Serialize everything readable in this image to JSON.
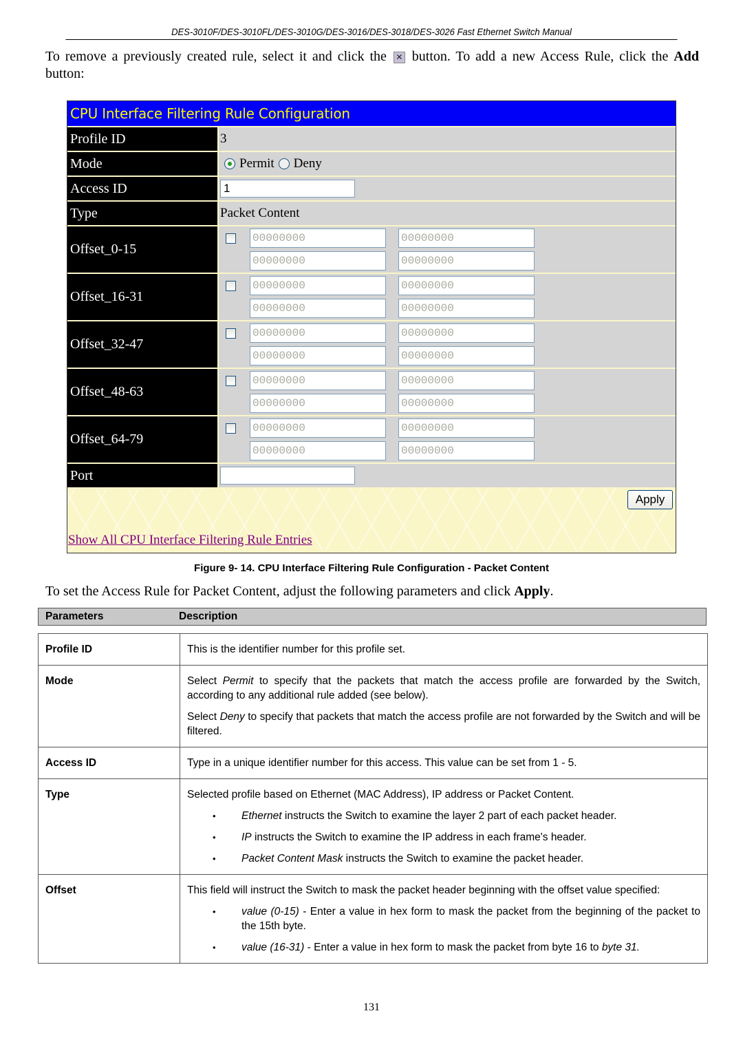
{
  "header": {
    "title": "DES-3010F/DES-3010FL/DES-3010G/DES-3016/DES-3018/DES-3026 Fast Ethernet Switch Manual"
  },
  "intro": {
    "part1": "To remove a previously created rule, select it and click the",
    "icon": "remove-icon",
    "icon_glyph": "✕",
    "part2": "button. To add a new Access Rule, click the",
    "add_bold": "Add",
    "part3": "button:"
  },
  "figure": {
    "title": "CPU Interface Filtering Rule Configuration",
    "colors": {
      "title_bg": "#0000f8",
      "title_fg": "#f8f800",
      "label_bg": "#000000",
      "value_bg": "#d4d4d4",
      "panel_bg": "#fbf6c8",
      "link": "#800080"
    },
    "profile_id": {
      "label": "Profile ID",
      "value": "3"
    },
    "mode": {
      "label": "Mode",
      "options": [
        {
          "label": "Permit",
          "checked": true
        },
        {
          "label": "Deny",
          "checked": false
        }
      ]
    },
    "access_id": {
      "label": "Access ID",
      "value": "1"
    },
    "type": {
      "label": "Type",
      "value": "Packet Content"
    },
    "offsets": [
      {
        "label": "Offset_0-15",
        "checked": false,
        "values": [
          "00000000",
          "00000000",
          "00000000",
          "00000000"
        ]
      },
      {
        "label": "Offset_16-31",
        "checked": false,
        "values": [
          "00000000",
          "00000000",
          "00000000",
          "00000000"
        ]
      },
      {
        "label": "Offset_32-47",
        "checked": false,
        "values": [
          "00000000",
          "00000000",
          "00000000",
          "00000000"
        ]
      },
      {
        "label": "Offset_48-63",
        "checked": false,
        "values": [
          "00000000",
          "00000000",
          "00000000",
          "00000000"
        ]
      },
      {
        "label": "Offset_64-79",
        "checked": false,
        "values": [
          "00000000",
          "00000000",
          "00000000",
          "00000000"
        ]
      }
    ],
    "port": {
      "label": "Port",
      "value": ""
    },
    "apply_label": "Apply",
    "show_link": "Show All CPU Interface Filtering Rule Entries"
  },
  "caption": "Figure 9- 14. CPU Interface Filtering Rule Configuration - Packet Content",
  "para2": {
    "text": "To set the Access Rule for Packet Content, adjust the following parameters and click",
    "bold": "Apply",
    "end": "."
  },
  "table": {
    "headers": {
      "param": "Parameters",
      "desc": "Description"
    },
    "rows": {
      "profile_id": {
        "name": "Profile ID",
        "desc": "This is the identifier number for this profile set."
      },
      "mode": {
        "name": "Mode",
        "p1_pre": "Select ",
        "p1_em": "Permit",
        "p1_post": " to specify that the packets that match the access profile are forwarded by the Switch, according to any additional rule added (see below).",
        "p2_pre": "Select ",
        "p2_em": "Deny",
        "p2_post": " to specify that packets that match the access profile are not forwarded by the Switch and will be filtered."
      },
      "access_id": {
        "name": "Access ID",
        "desc": "Type in a unique identifier number for this access. This value can be set from 1 - 5."
      },
      "type": {
        "name": "Type",
        "desc": "Selected profile based on Ethernet (MAC Address), IP address or Packet Content.",
        "bullets": [
          {
            "em": "Ethernet",
            "text": " instructs the Switch to examine the layer 2 part of each packet header."
          },
          {
            "em": "IP",
            "text": " instructs the Switch to examine the IP address in each frame's header."
          },
          {
            "em": "Packet Content Mask",
            "text": " instructs the Switch to examine the packet header."
          }
        ]
      },
      "offset": {
        "name": "Offset",
        "desc": "This field will instruct the Switch to mask the packet header beginning with the offset value specified:",
        "bullets": [
          {
            "em": "value (0-15)",
            "text": " - Enter a value in hex form to mask the packet from the beginning of the packet to the 15th byte."
          },
          {
            "em": "value (16-31)",
            "text": " - Enter a value in hex form to mask the packet from byte 16 to ",
            "em2": "byte 31."
          }
        ]
      }
    }
  },
  "page_number": "131"
}
